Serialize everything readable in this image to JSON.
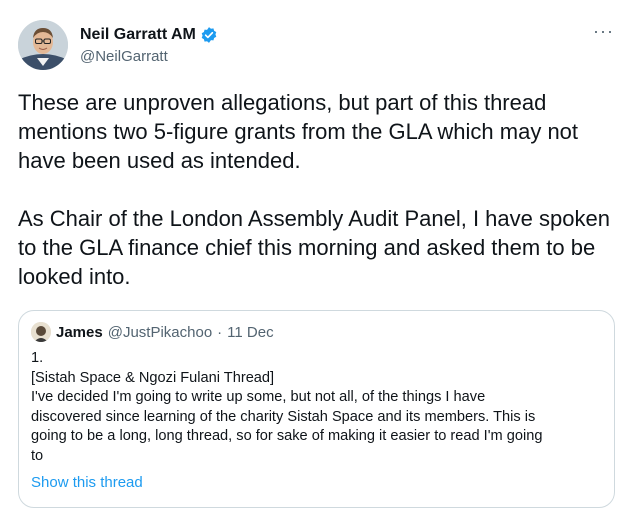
{
  "author": {
    "display_name": "Neil Garratt AM",
    "handle": "@NeilGarratt",
    "verified_icon": "verified-badge-icon"
  },
  "more_icon": "more-options-icon",
  "more_label": "···",
  "tweet": {
    "paragraphs": [
      "These are unproven allegations, but part of this thread mentions two 5-figure grants from the GLA which may not have been used as intended.",
      "As Chair of the London Assembly Audit Panel, I have spoken to the GLA finance chief this morning and asked them to be looked into."
    ]
  },
  "quoted_tweet": {
    "display_name": "James",
    "handle": "@JustPikachoo",
    "separator": "·",
    "date": "11 Dec",
    "lines": [
      "1.",
      "[Sistah Space & Ngozi Fulani Thread]",
      "I've decided I'm going to write up some, but not all, of the things I have",
      "discovered since learning of the charity Sistah Space and its members. This is",
      "going to be a long, long thread, so for sake of making it easier to read I'm going",
      "to"
    ],
    "show_thread_label": "Show this thread"
  },
  "colors": {
    "text": "#0f1419",
    "secondary": "#536471",
    "link": "#1d9bf0",
    "border": "#cfd9de"
  }
}
